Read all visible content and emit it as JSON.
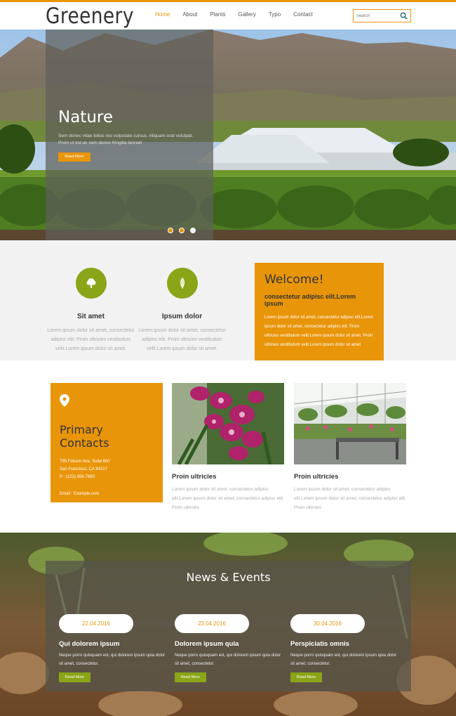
{
  "header": {
    "logo": "Greenery",
    "nav": [
      "Home",
      "About",
      "Plants",
      "Gallery",
      "Typo",
      "Contact"
    ],
    "search_placeholder": "Search"
  },
  "hero": {
    "title": "Nature",
    "text": "Sem donec vitae tellus nisi vulputate cursus. Aliquam erat volutpat. Proin ut est ac sem donec fringilla laoreet",
    "button": "Read More",
    "slides_total": 3,
    "active_slide": 3
  },
  "features": [
    {
      "icon": "tree-icon",
      "title": "Sit amet",
      "text": "Lorem ipsum dolor sit amet, consectetur adipisc elit. Proin ultricies vestibulum velit.Lorem ipsum dolor sit amet."
    },
    {
      "icon": "leaf-icon",
      "title": "Ipsum dolor",
      "text": "Lorem ipsum dolor sit amet, consectetur adipisc elit. Proin ultricies vestibulum velit.Lorem ipsum dolor sit amet."
    }
  ],
  "welcome": {
    "title": "Welcome!",
    "subtitle": "consectetur adipisc elit.Lorem ipsum",
    "text": "Lorem ipsum dolor sit amet, consectetur adipisc elit.Lorem ipsum dolor sit amet, consectetur adipisc elit. Proin ultricies vestibulum velit.Lorem ipsum dolor sit amet. Proin ultricies vestibulum velit.Lorem ipsum dolor sit amet."
  },
  "contacts": {
    "title": "Primary Contacts",
    "address_line1": "795 Folsom Ave, Suite 600",
    "address_line2": "San Francisco, CA 94107",
    "phone": "P : (123) 456-7890",
    "email_label": "Email :",
    "email": "Example.com"
  },
  "cards": [
    {
      "title": "Proin ultricies",
      "text": "Lorem ipsum dolor sit amet, consectetur adipisc elit.Lorem ipsum dolor sit amet, consectetur adipisc elit. Proin ultricies"
    },
    {
      "title": "Proin ultricies",
      "text": "Lorem ipsum dolor sit amet, consectetur adipisc elit.Lorem ipsum dolor sit amet, consectetur adipisc elit. Proin ultricies"
    }
  ],
  "news": {
    "title": "News & Events",
    "items": [
      {
        "date": "22.04.2016",
        "title": "Qui dolorem ipsum",
        "text": "Neque porro quisquam est, qui dolorem ipsum quia dolor sit amet, consectetur.",
        "button": "Read More"
      },
      {
        "date": "23.04.2016",
        "title": "Dolorem ipsum quia",
        "text": "Neque porro quisquam est, qui dolorem ipsum quia dolor sit amet, consectetur.",
        "button": "Read More"
      },
      {
        "date": "30.04.2016",
        "title": "Perspiciatis omnis",
        "text": "Neque porro quisquam est, qui dolorem ipsum quia dolor sit amet, consectetur.",
        "button": "Read More"
      }
    ]
  },
  "colors": {
    "accent": "#e8950a",
    "green": "#8aa517"
  }
}
